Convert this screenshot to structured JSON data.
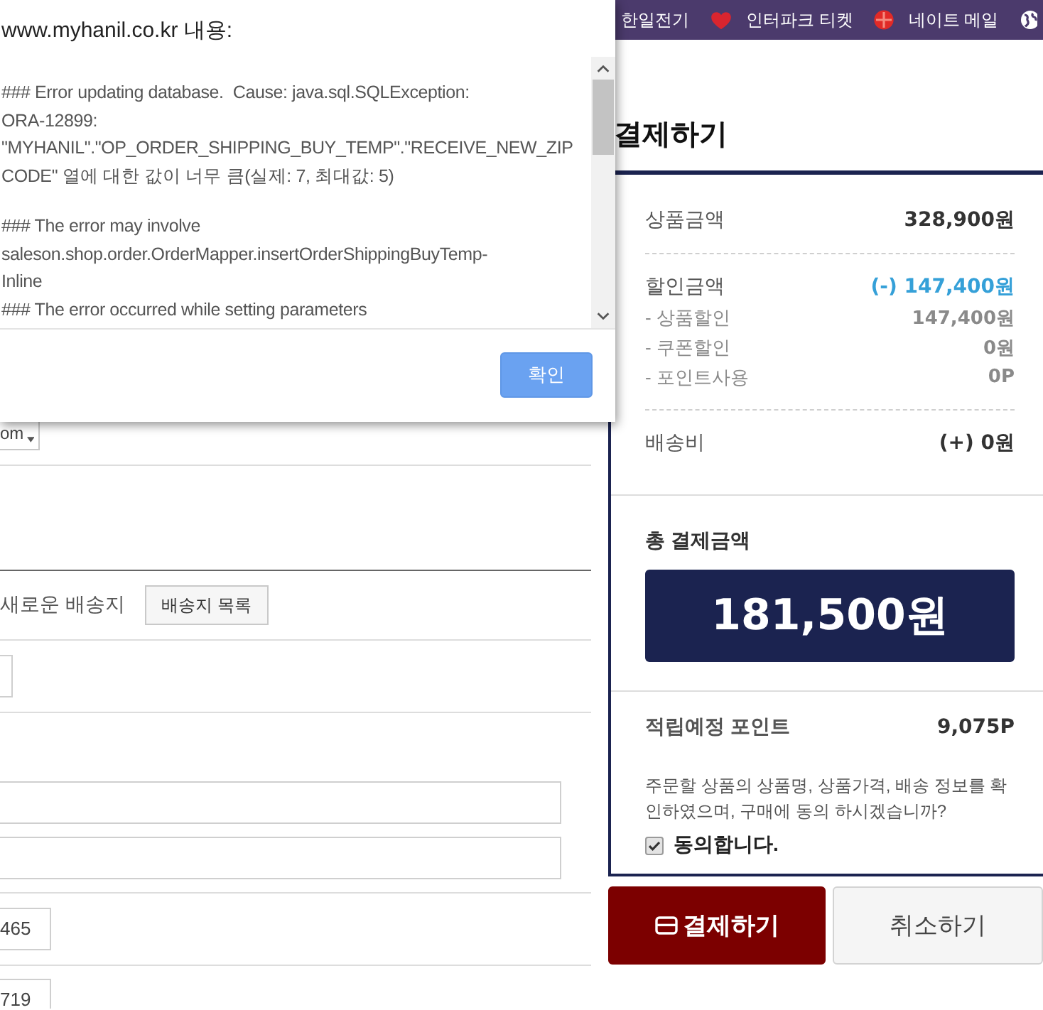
{
  "bookmarks_bar": {
    "bookmarks": [
      {
        "label": "한일전기"
      },
      {
        "label": "인터파크 티켓"
      },
      {
        "label": "네이트 메일"
      }
    ]
  },
  "dialog": {
    "title": "www.myhanil.co.kr 내용:",
    "message": [
      {
        "paragraphs": [
          {
            "lines": [
              "### Error updating database.  Cause: java.sql.SQLException:",
              "ORA-12899:",
              "\"MYHANIL\".\"OP_ORDER_SHIPPING_BUY_TEMP\".\"RECEIVE_NEW_ZIP",
              "CODE\" 열에 대한 값이 너무 큼(실제: 7, 최대값: 5)"
            ]
          }
        ]
      },
      {
        "paragraphs": [
          {
            "lines": [
              "### The error may involve",
              "saleson.shop.order.OrderMapper.insertOrderShippingBuyTemp-",
              "Inline"
            ]
          },
          {
            "lines": [
              "### The error occurred while setting parameters"
            ]
          }
        ]
      }
    ],
    "button": "확인"
  },
  "shipping_form": {
    "email_domain_select": {
      "value": "om"
    },
    "address_option": "새로운 배송지",
    "address_list_button": "배송지 목록",
    "number_fields": [
      {
        "value": "465"
      },
      {
        "value": "719"
      }
    ]
  },
  "summary": {
    "heading": "결제하기",
    "groups": [
      [
        {
          "kind": "main",
          "label": "상품금액",
          "value": "328,900원"
        }
      ],
      [
        {
          "kind": "discount",
          "label": "할인금액",
          "value": "(-) 147,400원"
        },
        {
          "kind": "sub",
          "label": "- 상품할인",
          "value": "147,400원"
        },
        {
          "kind": "sub",
          "label": "- 쿠폰할인",
          "value": "0원"
        },
        {
          "kind": "sub",
          "label": "- 포인트사용",
          "value": "0P"
        }
      ],
      [
        {
          "kind": "main",
          "label": "배송비",
          "value": "(+) 0원"
        }
      ]
    ],
    "total": {
      "label": "총 결제금액",
      "value": "181,500원"
    },
    "points": {
      "label": "적립예정 포인트",
      "value": "9,075P"
    },
    "agreement": {
      "text": "주문할 상품의 상품명, 상품가격, 배송 정보를 확인하였으며, 구매에 동의 하시겠습니까?",
      "checkbox_label": "동의합니다.",
      "checked": true
    }
  },
  "actions": [
    {
      "kind": "primary",
      "label": "결제하기"
    },
    {
      "kind": "secondary",
      "label": "취소하기"
    }
  ]
}
